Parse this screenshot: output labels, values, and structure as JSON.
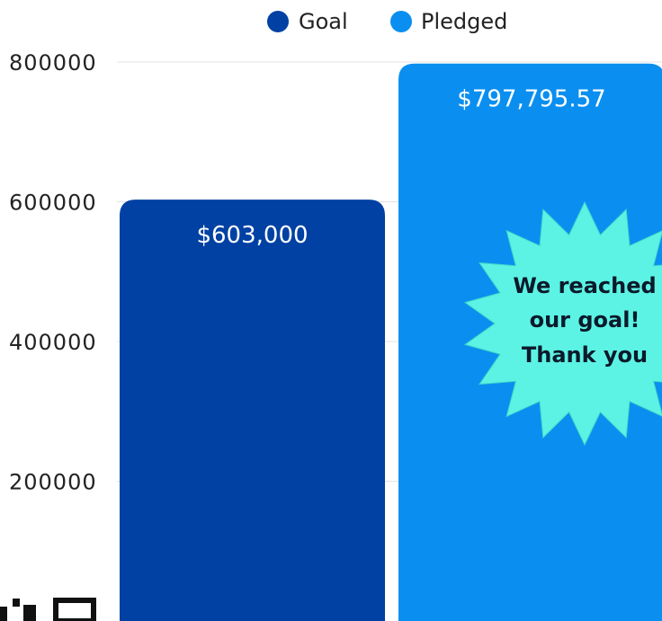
{
  "chart_data": {
    "type": "bar",
    "categories": [
      "Goal",
      "Pledged"
    ],
    "values": [
      603000,
      797795.57
    ],
    "value_labels": [
      "$603,000",
      "$797,795.57"
    ],
    "title": "",
    "xlabel": "",
    "ylabel": "",
    "ylim": [
      0,
      800000
    ],
    "y_ticks": [
      {
        "value": 200000,
        "label": "200000"
      },
      {
        "value": 400000,
        "label": "400000"
      },
      {
        "value": 600000,
        "label": "600000"
      },
      {
        "value": 800000,
        "label": "800000"
      }
    ],
    "grid": true,
    "legend_position": "top-center",
    "series": [
      {
        "name": "Goal",
        "color": "#0041a3"
      },
      {
        "name": "Pledged",
        "color": "#0a8ff0"
      }
    ],
    "annotation": {
      "lines": [
        "We reached",
        "our goal!",
        "Thank you"
      ],
      "color": "#5cf3e4"
    }
  }
}
